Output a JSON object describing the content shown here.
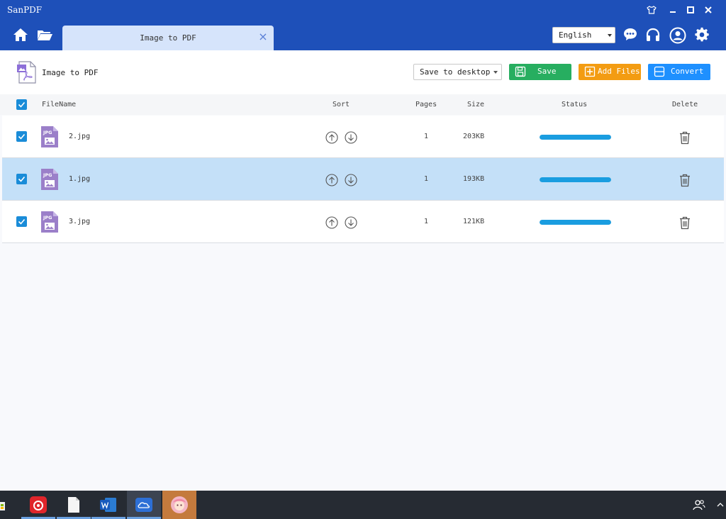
{
  "window": {
    "title": "SanPDF"
  },
  "nav": {
    "tab_label": "Image to PDF",
    "language": "English",
    "icons": [
      "home-icon",
      "folder-icon",
      "chat-icon",
      "headphones-icon",
      "account-icon",
      "gear-icon"
    ]
  },
  "toolbar": {
    "title": "Image to PDF",
    "save_location": "Save to desktop",
    "save_label": "Save",
    "add_files_label": "Add Files",
    "convert_label": "Convert"
  },
  "table": {
    "headers": {
      "filename": "FileName",
      "sort": "Sort",
      "pages": "Pages",
      "size": "Size",
      "status": "Status",
      "delete": "Delete"
    },
    "rows": [
      {
        "filename": "2.jpg",
        "pages": "1",
        "size": "203KB",
        "progress": 1.0,
        "selected": false,
        "checked": true
      },
      {
        "filename": "1.jpg",
        "pages": "1",
        "size": "193KB",
        "progress": 1.0,
        "selected": true,
        "checked": true
      },
      {
        "filename": "3.jpg",
        "pages": "1",
        "size": "121KB",
        "progress": 1.0,
        "selected": false,
        "checked": true
      }
    ]
  },
  "icon_badge": "JPG",
  "colors": {
    "titlebar": "#1e50b9",
    "save_button": "#27ae60",
    "add_button": "#f39c12",
    "convert_button": "#1e90ff",
    "progress": "#1a9de0",
    "selected_row": "#c4e0f8"
  }
}
